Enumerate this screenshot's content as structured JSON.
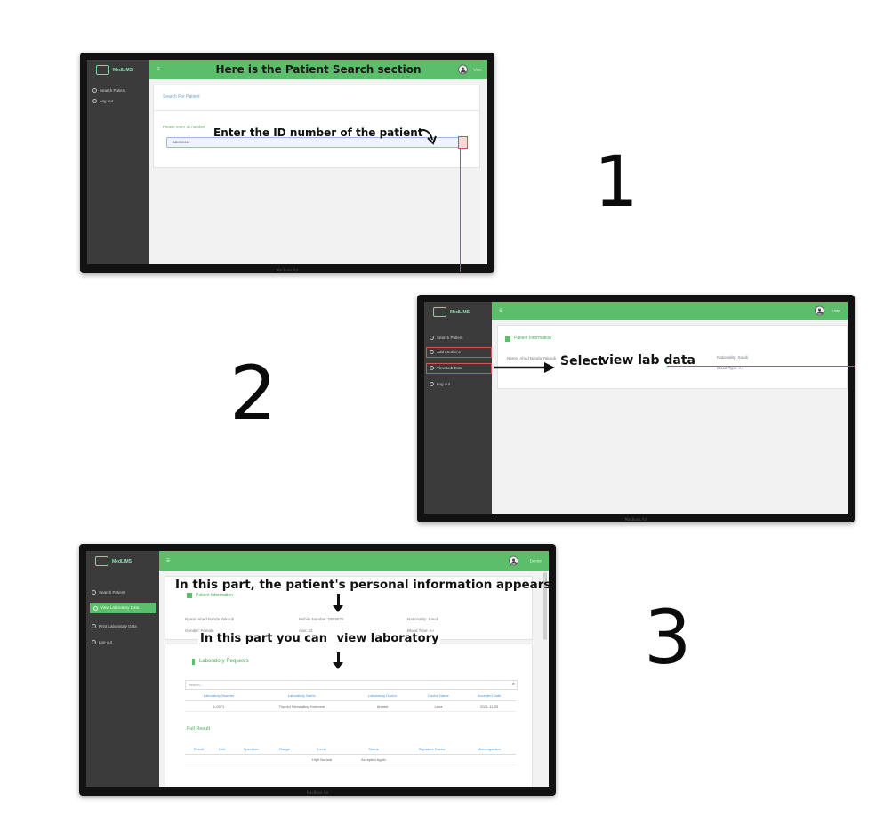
{
  "steps": [
    {
      "number": "1",
      "app": {
        "logo_text": "MedLIMS",
        "device_label": "MacBook Air"
      },
      "sidebar": [
        {
          "label": "Search Patient"
        },
        {
          "label": "Log out"
        }
      ],
      "topbar": {
        "title": "Here is the Patient Search section",
        "user": "User"
      },
      "search": {
        "link": "Search For Patient",
        "field_label": "Please enter ID number",
        "input_value": "ABM00411"
      },
      "annotation": "Enter the ID number of the patient"
    },
    {
      "number": "2",
      "app": {
        "logo_text": "MedLIMS",
        "device_label": "MacBook Air"
      },
      "sidebar": [
        {
          "label": "Search Patient"
        },
        {
          "label": "Add Medicine"
        },
        {
          "label": "View Lab Data"
        },
        {
          "label": "Log out"
        }
      ],
      "topbar": {
        "user": "User"
      },
      "panel": {
        "heading": "Patient Information",
        "name_field": "Name: Ahed Banda Yakoub",
        "right_field": "Nationality: Saudi",
        "right_field2": "Blood Type: A+"
      },
      "annotation_select": "Select",
      "annotation_view": "view lab data"
    },
    {
      "number": "3",
      "app": {
        "logo_text": "MedLIMS",
        "device_label": "MacBook Air"
      },
      "sidebar": [
        {
          "label": "Search Patient"
        },
        {
          "label": "View Laboratory Data"
        },
        {
          "label": "Print Laboratory Data"
        },
        {
          "label": "Log out"
        }
      ],
      "topbar": {
        "user": "Doctor"
      },
      "annotation_top": "In this part, the patient's personal information appears",
      "annotation_mid_a": "In this part you can",
      "annotation_mid_b": "view laboratory",
      "info": {
        "heading": "Patient Information",
        "name": "Name: Ahed Banda Yakoub",
        "gender": "Gender: Female",
        "number": "Mobile Number: 0555675",
        "age": "Age: 22",
        "nationality": "Nationality: Saudi",
        "blood": "Blood Type: A+"
      },
      "requests": {
        "heading": "Laboratory Requests",
        "search_placeholder": "Search...",
        "columns": [
          "Laboratory Number",
          "Laboratory Name",
          "Laboratory Doctor",
          "Doctor Name",
          "Accepted Date"
        ],
        "row": [
          "L-0071",
          "Thyroid Stimulating Hormone",
          "Ahmed",
          "Lana",
          "2021-11-25"
        ]
      },
      "full_result": {
        "heading": "Full Result",
        "columns": [
          "Result",
          "Unit",
          "Specimen",
          "Range",
          "Level",
          "Status",
          "Signature Doctor",
          "Microorganism"
        ],
        "level": "High Normal",
        "status": "Accepted Again"
      }
    }
  ]
}
